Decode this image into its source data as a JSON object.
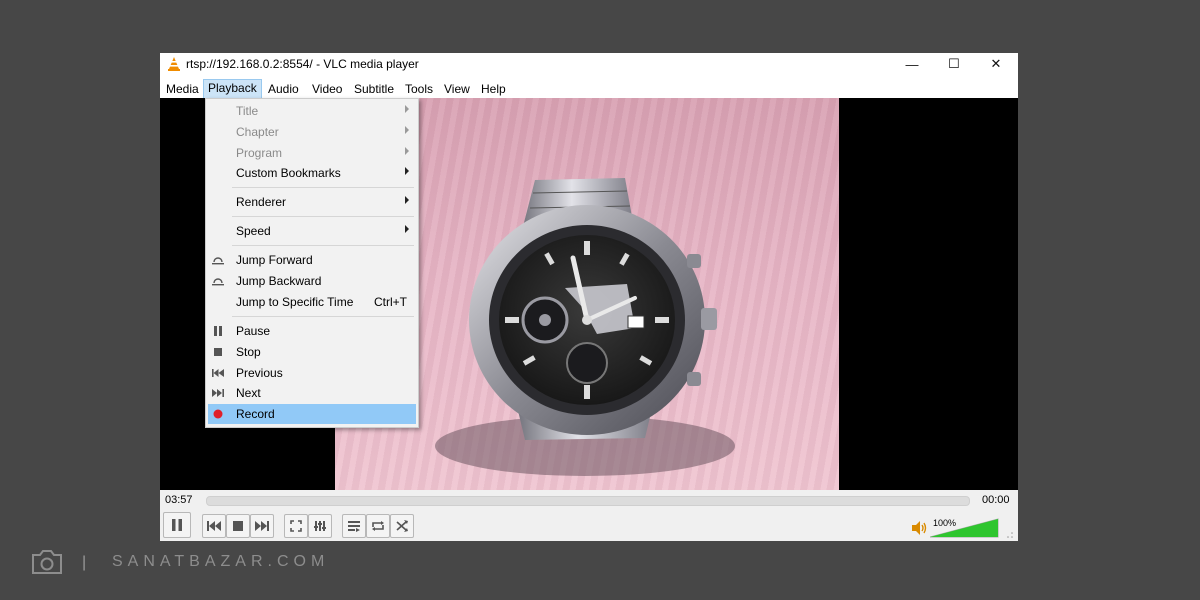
{
  "window": {
    "title": "rtsp://192.168.0.2:8554/ - VLC media player",
    "controls": {
      "minimize": "—",
      "maximize": "☐",
      "close": "✕"
    }
  },
  "menubar": [
    "Media",
    "Playback",
    "Audio",
    "Video",
    "Subtitle",
    "Tools",
    "View",
    "Help"
  ],
  "playback_menu": {
    "items": {
      "title": "Title",
      "chapter": "Chapter",
      "program": "Program",
      "custom_bookmarks": "Custom Bookmarks",
      "renderer": "Renderer",
      "speed": "Speed",
      "jump_forward": "Jump Forward",
      "jump_backward": "Jump Backward",
      "jump_to_time": "Jump to Specific Time",
      "jump_to_time_shortcut": "Ctrl+T",
      "pause": "Pause",
      "stop": "Stop",
      "previous": "Previous",
      "next": "Next",
      "record": "Record"
    },
    "highlighted": "Record"
  },
  "player": {
    "elapsed": "03:57",
    "remaining": "00:00",
    "seek_progress": 0,
    "volume_label": "100%",
    "volume_level": 1.0
  },
  "colors": {
    "accent_highlight": "#91c9f7",
    "record_dot": "#e0202a",
    "volume_green": "#2ec52e",
    "background": "#474747"
  },
  "footer": {
    "separator": "|",
    "brand": "SANATBAZAR.COM"
  }
}
